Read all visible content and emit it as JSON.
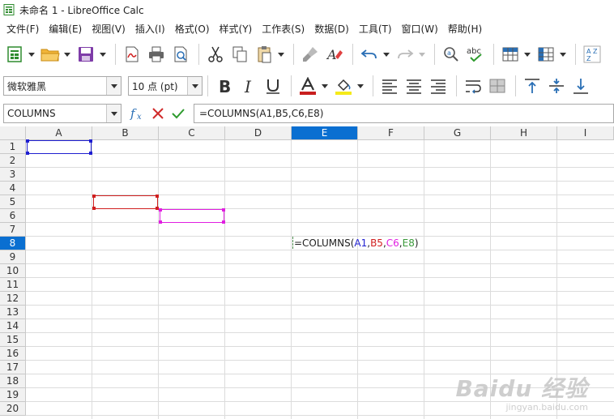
{
  "window": {
    "title": "未命名 1 - LibreOffice Calc"
  },
  "menu": [
    "文件(F)",
    "编辑(E)",
    "视图(V)",
    "插入(I)",
    "格式(O)",
    "样式(Y)",
    "工作表(S)",
    "数据(D)",
    "工具(T)",
    "窗口(W)",
    "帮助(H)"
  ],
  "font": {
    "name": "微软雅黑",
    "size": "10 点 (pt)"
  },
  "formula_bar": {
    "name_box": "COLUMNS",
    "formula": "=COLUMNS(A1,B5,C6,E8)"
  },
  "grid": {
    "columns": [
      "A",
      "B",
      "C",
      "D",
      "E",
      "F",
      "G",
      "H",
      "I"
    ],
    "rows": [
      "1",
      "2",
      "3",
      "4",
      "5",
      "6",
      "7",
      "8",
      "9",
      "10",
      "11",
      "12",
      "13",
      "14",
      "15",
      "16",
      "17",
      "18",
      "19",
      "20"
    ],
    "active_column": "E",
    "active_row": "8"
  },
  "cell_edit": {
    "prefix": "=COLUMNS(",
    "ref_a1": "A1",
    "sep1": ",",
    "ref_b5": "B5",
    "sep2": ",",
    "ref_c6": "C6",
    "sep3": ",",
    "ref_e8": "E8",
    "suffix": ")"
  },
  "colors": {
    "ref_a1": "#1f1fd0",
    "ref_b5": "#d01f1f",
    "ref_c6": "#e01fe0",
    "ref_e8": "#3a9a3a",
    "accent": "#0a6fd1"
  },
  "watermark": {
    "main": "Baidu 经验",
    "sub": "jingyan.baidu.com"
  }
}
